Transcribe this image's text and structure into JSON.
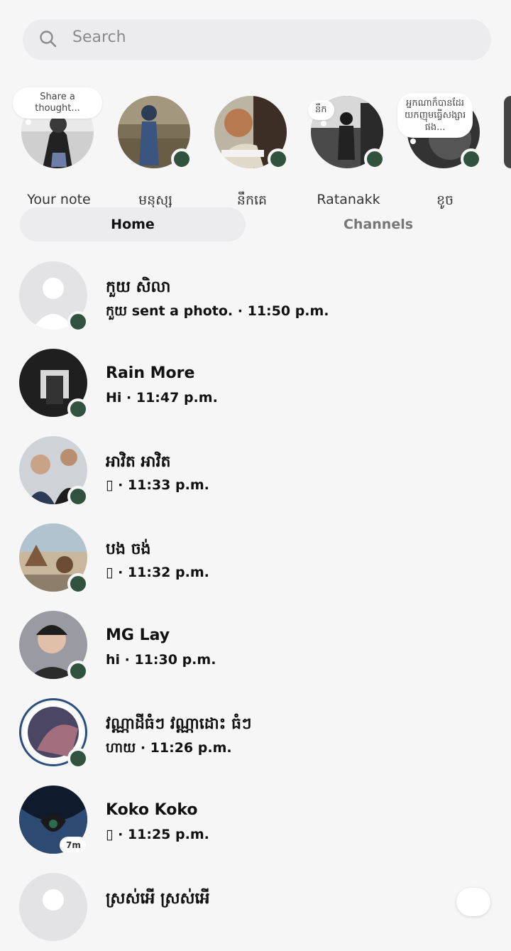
{
  "search": {
    "placeholder": "Search",
    "icon": "search-icon"
  },
  "notes": [
    {
      "label": "Your note",
      "bubble": "Share a\nthought...",
      "online": false
    },
    {
      "label": "មនុស្ស",
      "bubble": "",
      "online": true
    },
    {
      "label": "នឹកគេ",
      "bubble": "",
      "online": true
    },
    {
      "label": "Ratanakk",
      "bubble": "នឹក",
      "online": true
    },
    {
      "label": "ខូច",
      "bubble": "អ្នកណាក៏បានដែរ\nយកញុមធ្វើសង្សារ\nផង...",
      "online": true
    }
  ],
  "tabs": {
    "home": "Home",
    "channels": "Channels"
  },
  "chats": [
    {
      "name": "កួយ សិលា",
      "preview": "កួយ sent a photo. · 11:50 p.m.",
      "online": true
    },
    {
      "name": "Rain More",
      "preview": "Hi · 11:47 p.m.",
      "online": true
    },
    {
      "name": "អាវិត អាវិត",
      "preview": "▯ · 11:33 p.m.",
      "online": true
    },
    {
      "name": "បង ចង់",
      "preview": "▯ · 11:32 p.m.",
      "online": true
    },
    {
      "name": "MG Lay",
      "preview": "hi · 11:30 p.m.",
      "online": true
    },
    {
      "name": "វណ្ណាដីធំៗ វណ្ណាដោះ ធំៗ",
      "preview": "ហាយ · 11:26 p.m.",
      "online": true
    },
    {
      "name": "Koko Koko",
      "preview": "▯ · 11:25 p.m.",
      "online": false,
      "badge": "7m"
    },
    {
      "name": "ស្រស់អើ ស្រស់អើ",
      "preview": "",
      "online": false
    }
  ],
  "colors": {
    "online": "#31523f",
    "background": "#f6f6f7"
  }
}
